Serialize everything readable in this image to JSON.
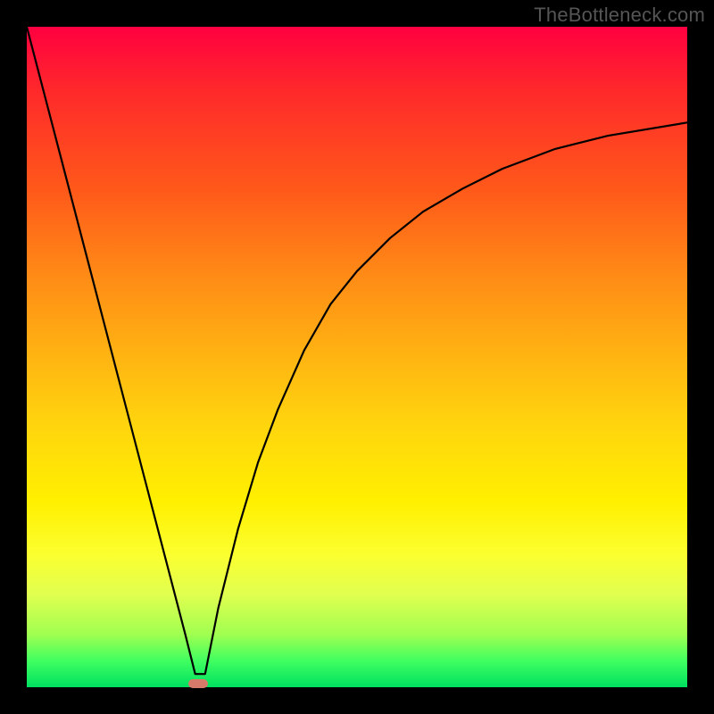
{
  "watermark": "TheBottleneck.com",
  "chart_data": {
    "type": "line",
    "title": "",
    "xlabel": "",
    "ylabel": "",
    "xlim": [
      0,
      100
    ],
    "ylim": [
      0,
      100
    ],
    "grid": false,
    "series": [
      {
        "name": "curve",
        "x": [
          0,
          3,
          6,
          9,
          12,
          15,
          18,
          21,
          24,
          25.5,
          27,
          28,
          29,
          32,
          35,
          38,
          42,
          46,
          50,
          55,
          60,
          66,
          72,
          80,
          88,
          100
        ],
        "y": [
          100,
          88.5,
          77,
          65.5,
          54,
          42.5,
          31,
          19.5,
          8,
          2,
          2,
          7,
          12,
          24,
          34,
          42,
          51,
          58,
          63,
          68,
          72,
          75.5,
          78.5,
          81.5,
          83.5,
          85.5
        ]
      }
    ],
    "min_marker": {
      "x": 26,
      "y": 0.5
    },
    "gradient_stops": [
      {
        "pct": 0,
        "color": "#ff0040"
      },
      {
        "pct": 25,
        "color": "#ff5a1a"
      },
      {
        "pct": 50,
        "color": "#ffb412"
      },
      {
        "pct": 72,
        "color": "#fff000"
      },
      {
        "pct": 92,
        "color": "#a0ff50"
      },
      {
        "pct": 100,
        "color": "#00e060"
      }
    ]
  }
}
